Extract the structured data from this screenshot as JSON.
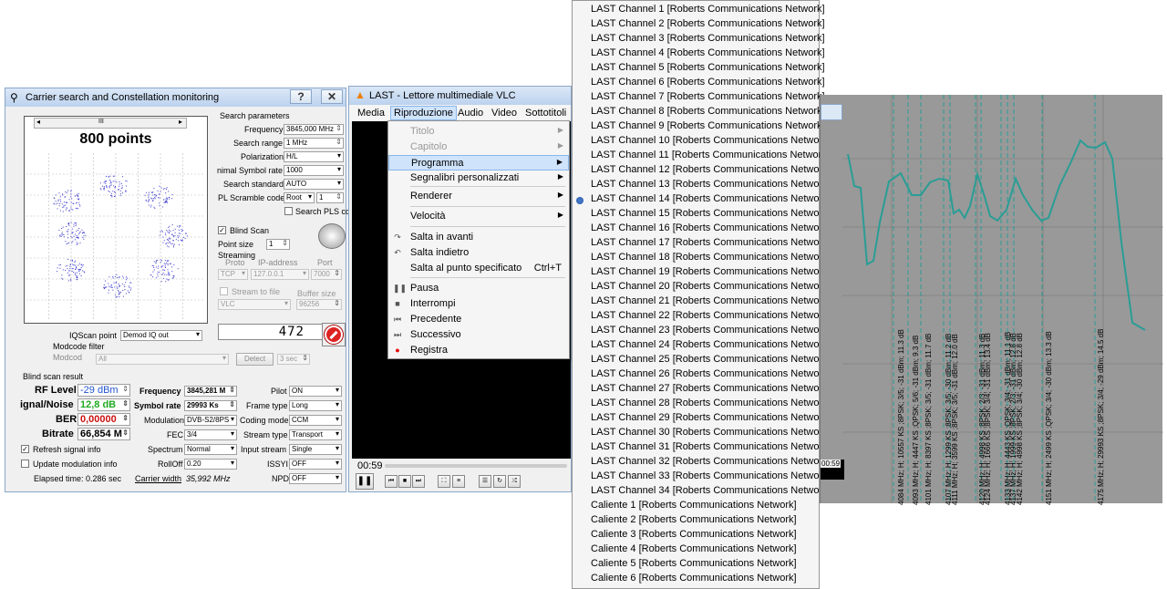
{
  "carrier": {
    "title": "Carrier search and Constellation monitoring",
    "help": "?",
    "close": "✕",
    "points_label": "800 points",
    "scroll_mid": "III",
    "search_params_header": "Search parameters",
    "frequency_label": "Frequency",
    "frequency_value": "3845,000 MHz",
    "search_range_label": "Search range",
    "search_range_value": "1 MHz",
    "polarization_label": "Polarization",
    "polarization_value": "H/L",
    "min_symrate_label": "nimal Symbol rate",
    "min_symrate_value": "1000",
    "search_standard_label": "Search standard",
    "search_standard_value": "AUTO",
    "pl_scramble_label": "PL Scramble code",
    "pl_scramble_value": "Root",
    "pl_scramble_num": "1",
    "search_pls_label": "Search PLS cc",
    "blind_scan_label": "Blind Scan",
    "point_size_label": "Point size",
    "point_size_value": "1",
    "streaming_label": "Streaming",
    "proto_label": "Proto",
    "ip_label": "IP-address",
    "port_label": "Port",
    "proto_value": "TCP",
    "ip_value": "127.0.0.1",
    "port_value": "7000",
    "stream_to_file_label": "Stream to file",
    "buffer_size_label": "Buffer size",
    "vlc_value": "VLC",
    "buffer_value": "96256",
    "counter_value": "472",
    "iqscan_label": "IQScan point",
    "iqscan_value": "Demod IQ out",
    "modcode_filter_label": "Modcode filter",
    "modcode_label": "Modcod",
    "modcode_value": "All",
    "detect_label": "Detect",
    "sec_value": "3 sec",
    "blind_scan_result_label": "Blind scan result",
    "rf_level_label": "RF Level",
    "rf_level_value": "-29 dBm",
    "sn_label": "ignal/Noise",
    "sn_value": "12,8 dB",
    "ber_label": "BER",
    "ber_value": "0,00000",
    "bitrate_label": "Bitrate",
    "bitrate_value": "66,854 M",
    "frequency2_label": "Frequency",
    "frequency2_value": "3845,281 M",
    "symbol_rate_label": "Symbol rate",
    "symbol_rate_value": "29993 Ks",
    "modulation_label": "Modulation",
    "modulation_value": "DVB-S2/8PS",
    "fec_label": "FEC",
    "fec_value": "3/4",
    "spectrum_label": "Spectrum",
    "spectrum_value": "Normal",
    "rolloff_label": "RollOff",
    "rolloff_value": "0.20",
    "carrier_width_label": "Carrier width",
    "carrier_width_value": "35,992 MHz",
    "pilot_label": "Pilot",
    "pilot_value": "ON",
    "frame_type_label": "Frame type",
    "frame_type_value": "Long",
    "coding_mode_label": "Coding mode",
    "coding_mode_value": "CCM",
    "stream_type_label": "Stream type",
    "stream_type_value": "Transport",
    "input_stream_label": "Input stream",
    "input_stream_value": "Single",
    "issyi_label": "ISSYI",
    "issyi_value": "OFF",
    "npd_label": "NPD",
    "npd_value": "OFF",
    "refresh_label": "Refresh signal info",
    "update_mod_label": "Update modulation info",
    "elapsed_label": "Elapsed time: 0.286 sec"
  },
  "vlc": {
    "title": "LAST - Lettore multimediale VLC",
    "menu": [
      "Media",
      "Riproduzione",
      "Audio",
      "Video",
      "Sottotitoli"
    ],
    "time_left": "00:59",
    "time_right": "00:59"
  },
  "playback_menu": [
    {
      "label": "Titolo",
      "disabled": true,
      "arrow": true
    },
    {
      "label": "Capitolo",
      "disabled": true,
      "arrow": true
    },
    {
      "label": "Programma",
      "arrow": true,
      "highlight": true
    },
    {
      "label": "Segnalibri personalizzati",
      "arrow": true
    },
    {
      "label": "Renderer",
      "arrow": true
    },
    {
      "label": "Velocità",
      "arrow": true
    },
    {
      "label": "Salta in avanti",
      "icon": "skip-forward-icon"
    },
    {
      "label": "Salta indietro",
      "icon": "skip-back-icon"
    },
    {
      "label": "Salta al punto specificato",
      "shortcut": "Ctrl+T"
    },
    {
      "label": "Pausa",
      "icon": "pause-icon"
    },
    {
      "label": "Interrompi",
      "icon": "stop-icon"
    },
    {
      "label": "Precedente",
      "icon": "previous-icon"
    },
    {
      "label": "Successivo",
      "icon": "next-icon"
    },
    {
      "label": "Registra",
      "icon": "record-icon"
    }
  ],
  "channels": [
    "LAST Channel 1 [Roberts Communications Network]",
    "LAST Channel 2 [Roberts Communications Network]",
    "LAST Channel 3 [Roberts Communications Network]",
    "LAST Channel 4 [Roberts Communications Network]",
    "LAST Channel 5 [Roberts Communications Network]",
    "LAST Channel 6 [Roberts Communications Network]",
    "LAST Channel 7 [Roberts Communications Network]",
    "LAST Channel 8 [Roberts Communications Network]",
    "LAST Channel 9 [Roberts Communications Network]",
    "LAST Channel 10 [Roberts Communications Network]",
    "LAST Channel 11 [Roberts Communications Network]",
    "LAST Channel 12 [Roberts Communications Network]",
    "LAST Channel 13 [Roberts Communications Network]",
    "LAST Channel 14 [Roberts Communications Network]",
    "LAST Channel 15 [Roberts Communications Network]",
    "LAST Channel 16 [Roberts Communications Network]",
    "LAST Channel 17 [Roberts Communications Network]",
    "LAST Channel 18 [Roberts Communications Network]",
    "LAST Channel 19 [Roberts Communications Network]",
    "LAST Channel 20 [Roberts Communications Network]",
    "LAST Channel 21 [Roberts Communications Network]",
    "LAST Channel 22 [Roberts Communications Network]",
    "LAST Channel 23 [Roberts Communications Network]",
    "LAST Channel 24 [Roberts Communications Network]",
    "LAST Channel 25 [Roberts Communications Network]",
    "LAST Channel 26 [Roberts Communications Network]",
    "LAST Channel 27 [Roberts Communications Network]",
    "LAST Channel 28 [Roberts Communications Network]",
    "LAST Channel 29 [Roberts Communications Network]",
    "LAST Channel 30 [Roberts Communications Network]",
    "LAST Channel 31 [Roberts Communications Network]",
    "LAST Channel 32 [Roberts Communications Network]",
    "LAST Channel 33 [Roberts Communications Network]",
    "LAST Channel 34 [Roberts Communications Network]",
    "Caliente 1 [Roberts Communications Network]",
    "Caliente 2 [Roberts Communications Network]",
    "Caliente 3 [Roberts Communications Network]",
    "Caliente 4 [Roberts Communications Network]",
    "Caliente 5 [Roberts Communications Network]",
    "Caliente 6 [Roberts Communications Network]"
  ],
  "selected_channel_index": 13,
  "spectrum": {
    "trace_color": "#2a9d95",
    "annotations": [
      "4084 MHz; H; 10557 KS ;8PSK; 3/5; -31 dBm; 11.3 dB",
      "4093 MHz; H; 4447 KS ;QPSK; 5/6; -31 dBm; 9.3 dB",
      "4101 MHz; H; 8397 KS ;8PSK; 3/5; -31 dBm; 11.7 dB",
      "4107 MHz; H; 1299 KS ;8PSK; 3/5; -30 dBm; 11.2 dB",
      "4111 MHz; H; 3599 KS ;8PSK; 3/5; -31 dBm; 12.0 dB",
      "4120 MHz; H; 4998 KS ;8PSK; 2/3; -31 dBm; 11.3 dB",
      "4124 MHz; H; 1666 KS ;8PSK; 3/4; -31 dBm; 13.4 dB",
      "4133 MHz; H; 4443 KS ;QPSK; 3/4; -31 dBm; 11.1 dB",
      "4137 MHz; H; 1999 KS ;8PSK; 2/3; -31 dBm; 12.8 dB",
      "4142 MHz; H; 4998 KS ;8PSK; 3/4; -30 dBm; 12.8 dB",
      "4151 MHz; H; 2499 KS ;QPSK; 3/4; -30 dBm; 13.3 dB",
      "4175 MHz; H; 29993 KS ;8PSK; 3/4; -29 dBm; 14.5 dB"
    ]
  }
}
